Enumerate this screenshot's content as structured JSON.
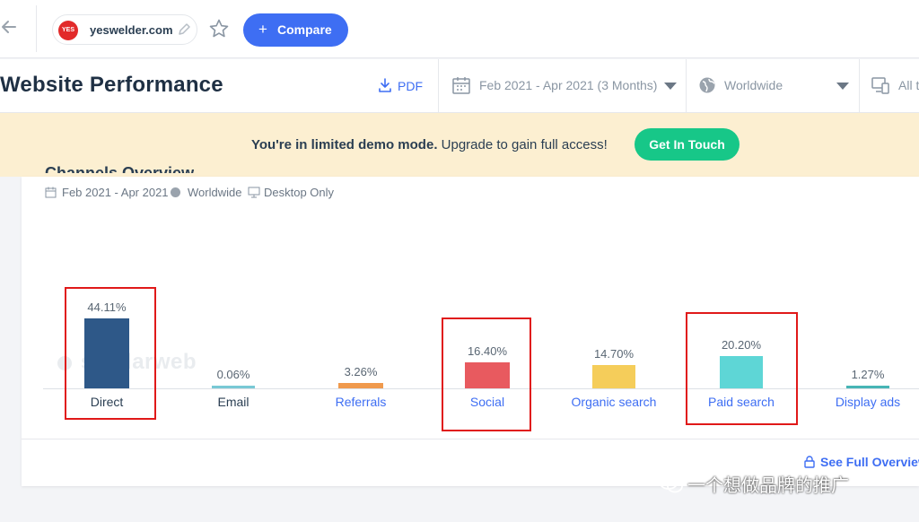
{
  "topbar": {
    "back_icon": "arrow-left-icon",
    "site": {
      "name": "yeswelder.com",
      "logo_text": "YES"
    },
    "compare_label": "Compare",
    "compare_color": "#3e6ef3"
  },
  "header": {
    "title": "Website Performance",
    "pdf_label": "PDF",
    "date_range": "Feb 2021 - Apr 2021 (3 Months)",
    "geo": "Worldwide",
    "device": "All traffic"
  },
  "banner": {
    "bold_text": "You're in limited demo mode.",
    "text": "Upgrade to gain full access!",
    "button_label": "Get In Touch",
    "button_color": "#17c788",
    "background": "#fcefd1"
  },
  "card": {
    "title": "Channels Overview",
    "meta_date": "Feb 2021 - Apr 2021",
    "meta_geo": "Worldwide",
    "meta_device": "Desktop Only",
    "watermark": "similarweb",
    "see_full_label": "See Full Overview"
  },
  "chart_data": {
    "type": "bar",
    "unit": "%",
    "categories": [
      "Direct",
      "Email",
      "Referrals",
      "Social",
      "Organic search",
      "Paid search",
      "Display ads"
    ],
    "values": [
      44.11,
      0.06,
      3.26,
      16.4,
      14.7,
      20.2,
      1.27
    ],
    "value_labels": [
      "44.11%",
      "0.06%",
      "3.26%",
      "16.40%",
      "14.70%",
      "20.20%",
      "1.27%"
    ],
    "colors": [
      "#2e5888",
      "#79c9d5",
      "#f09a4d",
      "#e85a5f",
      "#f5cd5a",
      "#5ed6d6",
      "#47b5b5"
    ],
    "label_colors": [
      "#2a3e52",
      "#2a3e52",
      "#3e6ef3",
      "#3e6ef3",
      "#3e6ef3",
      "#3e6ef3",
      "#3e6ef3"
    ],
    "highlighted": [
      "Direct",
      "Social",
      "Paid search"
    ]
  },
  "overlay": {
    "wechat_text": "一个想做品牌的推广"
  }
}
